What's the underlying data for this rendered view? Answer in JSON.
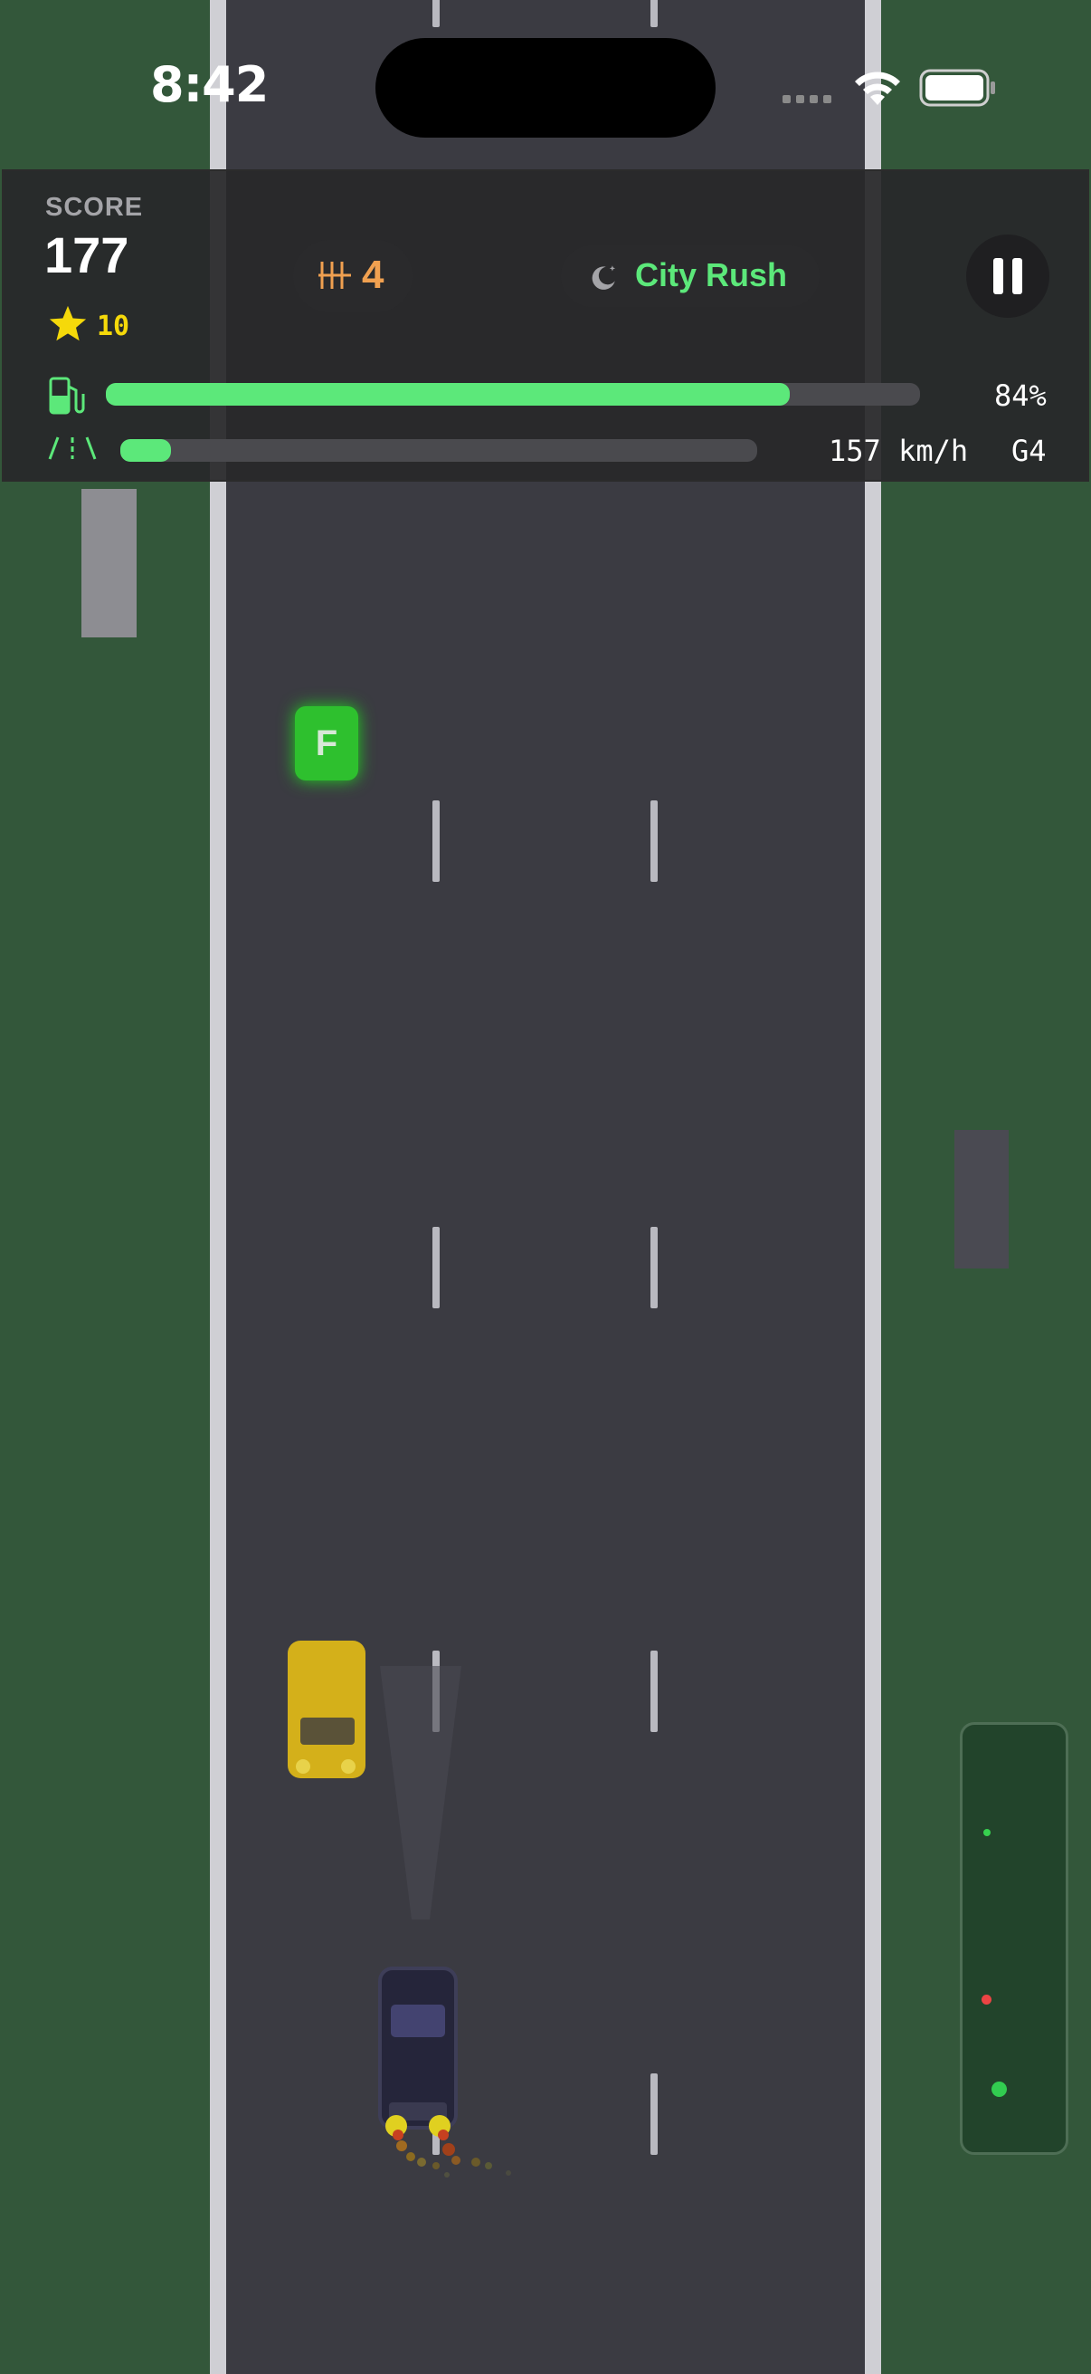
{
  "status_bar": {
    "time": "8:42",
    "battery_level": 1.0,
    "icons": [
      "signal-icon",
      "wifi-icon",
      "battery-icon"
    ]
  },
  "hud": {
    "score_label": "SCORE",
    "score": "177",
    "stars": "10",
    "gear_pill": "4",
    "mode_label": "City Rush",
    "fuel_percent_text": "84%",
    "fuel_level": 0.84,
    "speed_text": "157 km/h",
    "gear_text": "G4",
    "speed_level": 0.08,
    "icons": [
      "star-icon",
      "gears-icon",
      "moon-icon",
      "pause-icon",
      "fuel-pump-icon",
      "road-icon"
    ]
  },
  "pickups": {
    "fuel_letter": "F"
  },
  "colors": {
    "grass": "#33573a",
    "road": "#3b3b42",
    "accent_green": "#5ce87a",
    "star_yellow": "#f5d90a",
    "gear_orange": "#f0a050",
    "taxi": "#d4b01a",
    "player_car": "#25253a",
    "fuel_pickup": "#2ec02e"
  }
}
